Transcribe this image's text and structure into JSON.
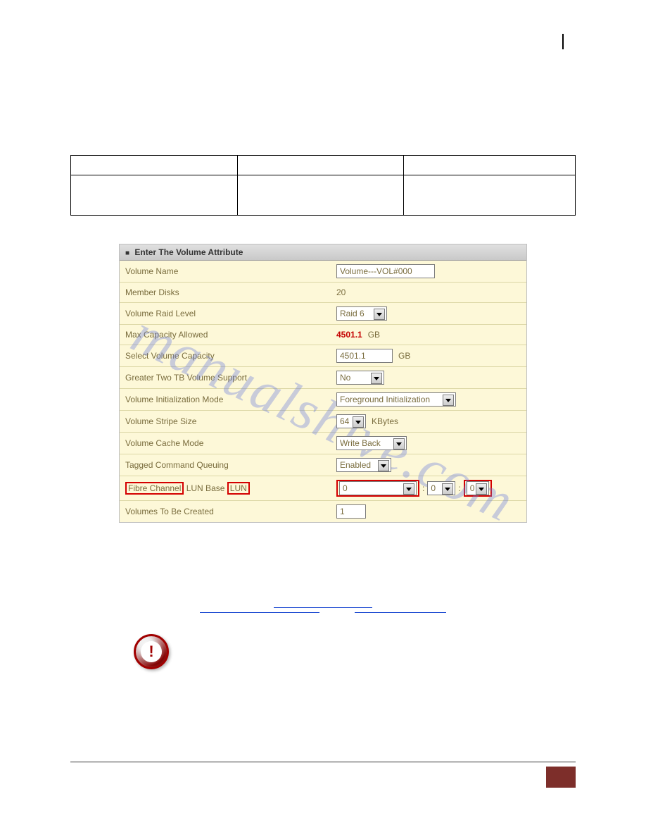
{
  "screenshot": {
    "header": "Enter The Volume Attribute",
    "rows": {
      "volume_name": {
        "label": "Volume Name",
        "value": "Volume---VOL#000"
      },
      "member_disks": {
        "label": "Member Disks",
        "value": "20"
      },
      "raid_level": {
        "label": "Volume Raid Level",
        "value": "Raid 6"
      },
      "max_cap": {
        "label": "Max Capacity Allowed",
        "value": "4501.1",
        "unit": "GB"
      },
      "sel_cap": {
        "label": "Select Volume Capacity",
        "value": "4501.1",
        "unit": "GB"
      },
      "two_tb": {
        "label": "Greater Two TB Volume Support",
        "value": "No"
      },
      "init_mode": {
        "label": "Volume Initialization Mode",
        "value": "Foreground Initialization"
      },
      "stripe": {
        "label": "Volume Stripe Size",
        "value": "64",
        "unit": "KBytes"
      },
      "cache": {
        "label": "Volume Cache Mode",
        "value": "Write Back"
      },
      "tcq": {
        "label": "Tagged Command Queuing",
        "value": "Enabled"
      },
      "fc": {
        "label_pre": "Fibre Channel",
        "label_mid": "LUN Base",
        "label_post": "LUN",
        "v1": "0",
        "v2": "0",
        "v3": "0"
      },
      "vol_create": {
        "label": "Volumes To Be Created",
        "value": "1"
      }
    }
  },
  "watermark": "manualshive.com"
}
